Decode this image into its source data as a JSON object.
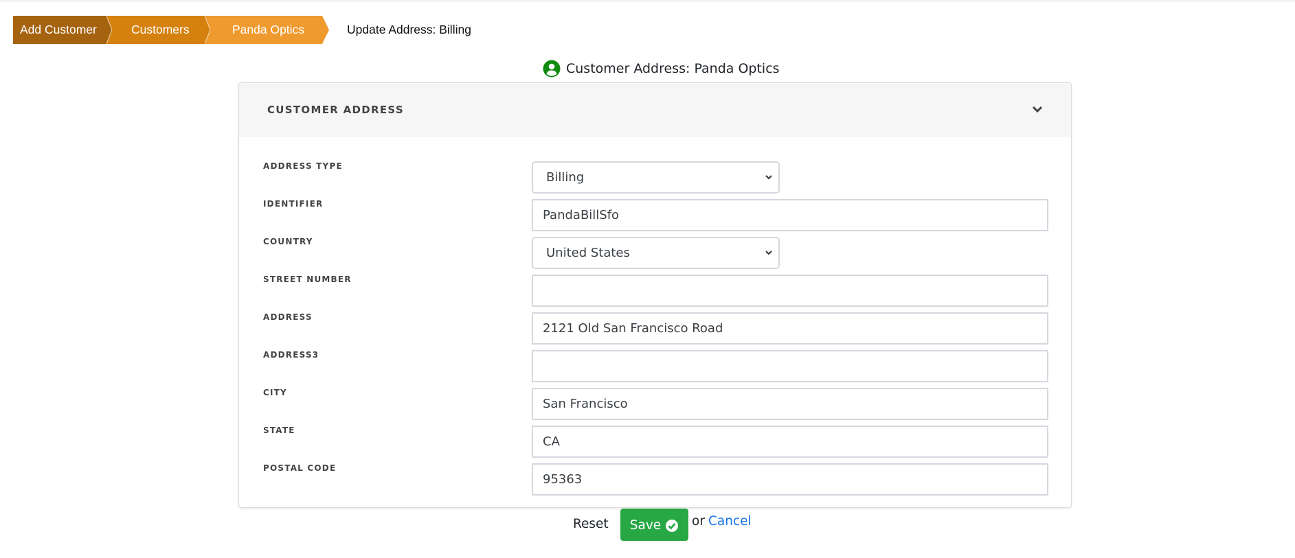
{
  "breadcrumb": {
    "items": [
      {
        "label": "Add Customer",
        "color": "#a5620f"
      },
      {
        "label": "Customers",
        "color": "#d5810f"
      },
      {
        "label": "Panda Optics",
        "color": "#ef9a2e"
      }
    ],
    "current": "Update Address: Billing"
  },
  "page": {
    "title": "Customer Address: Panda Optics",
    "title_icon": "user-circle-icon",
    "title_icon_color": "#118a11"
  },
  "card": {
    "title": "CUSTOMER ADDRESS",
    "collapse_icon": "chevron-down-icon"
  },
  "form": {
    "fields": [
      {
        "label": "ADDRESS TYPE",
        "type": "select",
        "value": "Billing"
      },
      {
        "label": "IDENTIFIER",
        "type": "input",
        "value": "PandaBillSfo"
      },
      {
        "label": "COUNTRY",
        "type": "select",
        "value": "United States"
      },
      {
        "label": "STREET NUMBER",
        "type": "input",
        "value": ""
      },
      {
        "label": "ADDRESS",
        "type": "input",
        "value": "2121 Old San Francisco Road"
      },
      {
        "label": "ADDRESS3",
        "type": "input",
        "value": ""
      },
      {
        "label": "CITY",
        "type": "input",
        "value": "San Francisco"
      },
      {
        "label": "STATE",
        "type": "input",
        "value": "CA"
      },
      {
        "label": "POSTAL CODE",
        "type": "input",
        "value": "95363"
      }
    ]
  },
  "actions": {
    "reset_label": "Reset",
    "save_label": "Save",
    "save_icon": "check-circle-icon",
    "save_color": "#28a745",
    "or_label": "or",
    "cancel_label": "Cancel",
    "link_color": "#1a73e8"
  }
}
